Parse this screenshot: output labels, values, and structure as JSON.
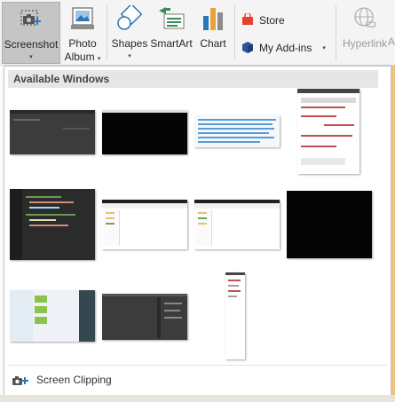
{
  "ribbon": {
    "screenshot": {
      "line1": "Screenshot",
      "caret": "▾"
    },
    "photo_album": {
      "line1": "Photo",
      "line2": "Album",
      "caret": "▾"
    },
    "shapes": {
      "line1": "Shapes",
      "caret": "▾"
    },
    "smartart": {
      "line1": "SmartArt"
    },
    "chart": {
      "line1": "Chart"
    },
    "store": {
      "label": "Store"
    },
    "my_addins": {
      "label": "My Add-ins",
      "caret": "▾"
    },
    "hyperlink": {
      "label": "Hyperlink"
    },
    "cut_off": "A"
  },
  "dropdown": {
    "header": "Available Windows",
    "thumbnails": [
      {
        "name": "window-thumb-dark-app"
      },
      {
        "name": "window-thumb-black"
      },
      {
        "name": "window-thumb-document-list"
      },
      {
        "name": "window-thumb-web-page"
      },
      {
        "name": "window-thumb-code-editor"
      },
      {
        "name": "window-thumb-file-explorer-1"
      },
      {
        "name": "window-thumb-file-explorer-2"
      },
      {
        "name": "window-thumb-black-2"
      },
      {
        "name": "window-thumb-settings-app"
      },
      {
        "name": "window-thumb-dark-editor"
      },
      {
        "name": "window-thumb-tall-narrow"
      }
    ],
    "footer_label": "Screen Clipping"
  },
  "colors": {
    "screenshot_pressed": "#c5c5c5",
    "store_red": "#e8412c",
    "addin_blue": "#2b579a",
    "smartart_green": "#3b8a5a",
    "chart_orange": "#e8a33a"
  }
}
